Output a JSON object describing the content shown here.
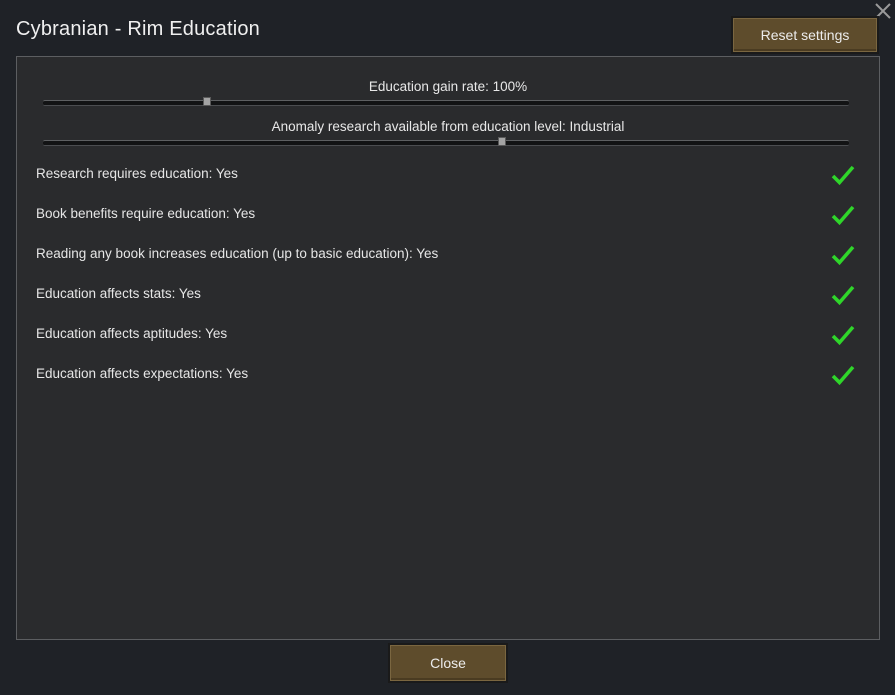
{
  "window": {
    "title": "Cybranian - Rim Education"
  },
  "toolbar": {
    "reset_label": "Reset settings",
    "close_label": "Close"
  },
  "sliders": [
    {
      "label": "Education gain rate: 100%",
      "value_fraction": 0.2
    },
    {
      "label": "Anomaly research available from education level: Industrial",
      "value_fraction": 0.57
    }
  ],
  "settings": [
    {
      "label": "Research requires education: Yes",
      "checked": true
    },
    {
      "label": "Book benefits require education: Yes",
      "checked": true
    },
    {
      "label": "Reading any book increases education (up to basic education): Yes",
      "checked": true
    },
    {
      "label": "Education affects stats: Yes",
      "checked": true
    },
    {
      "label": "Education affects aptitudes: Yes",
      "checked": true
    },
    {
      "label": "Education affects expectations: Yes",
      "checked": true
    }
  ],
  "colors": {
    "check_green": "#2fd62a",
    "button_brown": "#5e4c2c"
  }
}
